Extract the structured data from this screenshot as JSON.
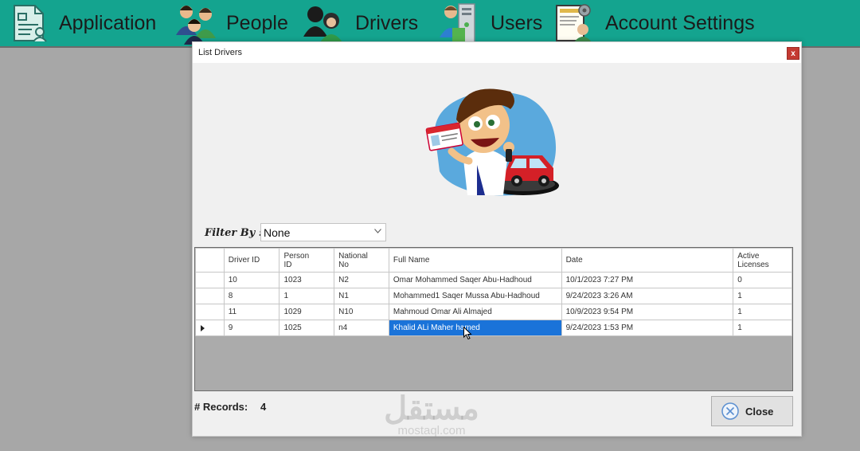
{
  "menu": {
    "items": [
      {
        "label": "Application",
        "icon": "application-form-icon"
      },
      {
        "label": "People",
        "icon": "people-icon"
      },
      {
        "label": "Drivers",
        "icon": "drivers-icon"
      },
      {
        "label": "Users",
        "icon": "users-icon"
      },
      {
        "label": "Account Settings",
        "icon": "account-settings-icon"
      }
    ]
  },
  "dialog": {
    "title": "List Drivers",
    "close_glyph": "x"
  },
  "filter": {
    "label": "Filter By :",
    "selected": "None"
  },
  "grid": {
    "columns": [
      "",
      "Driver ID",
      "Person ID",
      "National No",
      "Full Name",
      "Date",
      "Active Licenses"
    ],
    "rows": [
      {
        "driver_id": "10",
        "person_id": "1023",
        "national_no": "N2",
        "full_name": "Omar Mohammed Saqer Abu-Hadhoud",
        "date": "10/1/2023 7:27 PM",
        "active_licenses": "0"
      },
      {
        "driver_id": "8",
        "person_id": "1",
        "national_no": "N1",
        "full_name": "Mohammed1 Saqer Mussa Abu-Hadhoud",
        "date": "9/24/2023 3:26 AM",
        "active_licenses": "1"
      },
      {
        "driver_id": "11",
        "person_id": "1029",
        "national_no": "N10",
        "full_name": "Mahmoud Omar Ali Almajed",
        "date": "10/9/2023 9:54 PM",
        "active_licenses": "1"
      },
      {
        "driver_id": "9",
        "person_id": "1025",
        "national_no": "n4",
        "full_name": "Khalid ALi Maher hamed",
        "date": "9/24/2023 1:53 PM",
        "active_licenses": "1"
      }
    ],
    "selected_row": 3
  },
  "footer": {
    "records_label": "# Records:",
    "records_count": "4",
    "close_button_label": "Close"
  },
  "watermark": {
    "main": "مستقل",
    "sub": "mostaql.com"
  },
  "colors": {
    "menubar": "#14a48f",
    "selection": "#1a73d9",
    "close_x": "#c43a32"
  }
}
